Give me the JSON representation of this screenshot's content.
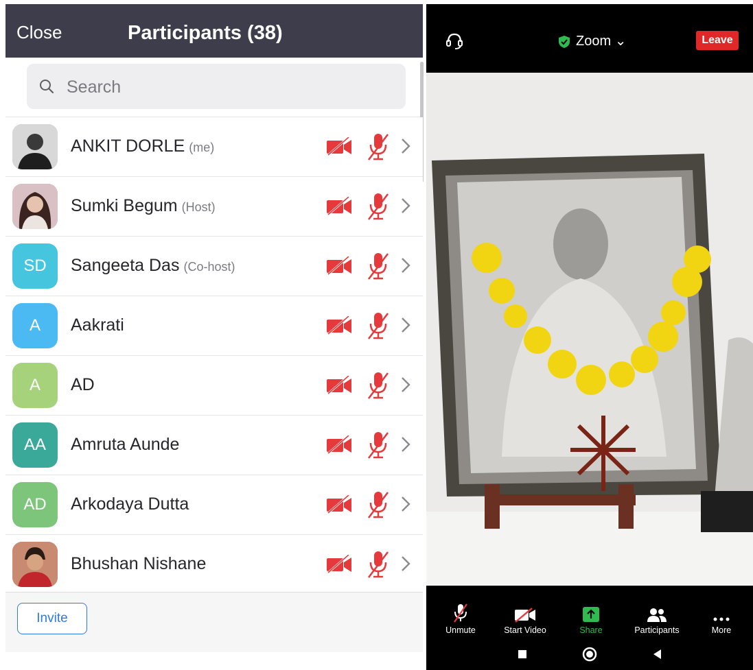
{
  "header": {
    "close_label": "Close",
    "title": "Participants (38)"
  },
  "search": {
    "placeholder": "Search"
  },
  "participants": [
    {
      "name": "ANKIT DORLE",
      "role": "(me)",
      "initials": "",
      "avatar_color": "#888888",
      "icon": "photo"
    },
    {
      "name": "Sumki Begum",
      "role": "(Host)",
      "initials": "",
      "avatar_color": "#c9a7a7",
      "icon": "photo"
    },
    {
      "name": "Sangeeta Das",
      "role": "(Co-host)",
      "initials": "SD",
      "avatar_color": "#45c6de"
    },
    {
      "name": "Aakrati",
      "role": "",
      "initials": "A",
      "avatar_color": "#4bb9f2"
    },
    {
      "name": "AD",
      "role": "",
      "initials": "A",
      "avatar_color": "#a6d27c"
    },
    {
      "name": "Amruta Aunde",
      "role": "",
      "initials": "AA",
      "avatar_color": "#3aa99a"
    },
    {
      "name": "Arkodaya Dutta",
      "role": "",
      "initials": "AD",
      "avatar_color": "#7cc57a"
    },
    {
      "name": "Bhushan Nishane",
      "role": "",
      "initials": "",
      "avatar_color": "#b06a55",
      "icon": "photo"
    }
  ],
  "footer": {
    "invite_label": "Invite"
  },
  "meeting": {
    "app_label": "Zoom",
    "leave_label": "Leave"
  },
  "toolbar": {
    "unmute": "Unmute",
    "start_video": "Start Video",
    "share": "Share",
    "participants": "Participants",
    "more": "More"
  },
  "colors": {
    "header_bg": "#3d3d4c",
    "muted_red": "#e5393c",
    "link_blue": "#2d7ae1",
    "share_green": "#2fbb4f",
    "leave_red": "#e02828"
  }
}
